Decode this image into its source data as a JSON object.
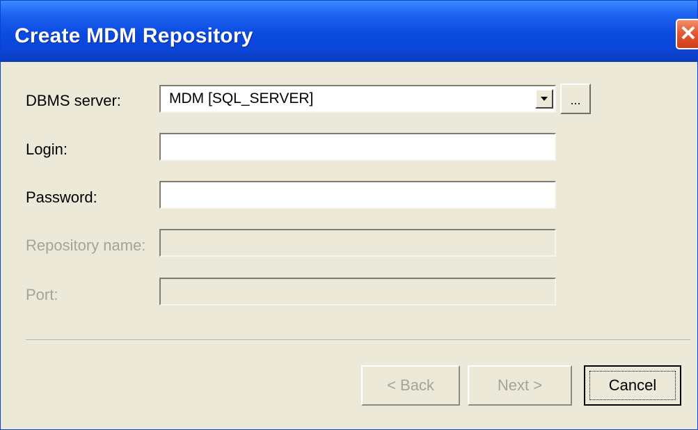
{
  "dialog": {
    "title": "Create MDM Repository",
    "close_icon": "close-icon"
  },
  "form": {
    "dbms_label": "DBMS server:",
    "dbms_value": "MDM  [SQL_SERVER]",
    "browse_label": "...",
    "login_label": "Login:",
    "login_value": "",
    "password_label": "Password:",
    "password_value": "",
    "repository_label": "Repository name:",
    "repository_value": "",
    "port_label": "Port:",
    "port_value": ""
  },
  "buttons": {
    "back": "< Back",
    "next": "Next >",
    "cancel": "Cancel"
  },
  "colors": {
    "titlebar": "#0a4ae0",
    "close": "#e35a33",
    "dialog_bg": "#ece9d8",
    "disabled_text": "#a5a39a"
  }
}
